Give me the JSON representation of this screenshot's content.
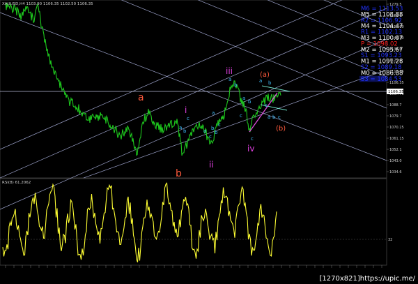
{
  "header": {
    "symbol_line": "XAUUSD,H4  1103.90 1106.35 1102.50 1106.35"
  },
  "levels": [
    {
      "label": "M6 = 1113.53",
      "color": "#2233ff",
      "highlight": false
    },
    {
      "label": "M5 = 1108.88",
      "color": "#ffffff",
      "highlight": false
    },
    {
      "label": "R2 = 1106.92",
      "color": "#2233ff",
      "highlight": false
    },
    {
      "label": "M4 = 1104.47",
      "color": "#ffffff",
      "highlight": false
    },
    {
      "label": "R1 = 1102.13",
      "color": "#2233ff",
      "highlight": false
    },
    {
      "label": "M3 = 1100.07",
      "color": "#ffffff",
      "highlight": false
    },
    {
      "label": "P = 1098.02",
      "color": "#ff2020",
      "highlight": false
    },
    {
      "label": "M2 = 1095.67",
      "color": "#ffffff",
      "highlight": false
    },
    {
      "label": "S1 = 1093.23",
      "color": "#2233ff",
      "highlight": false
    },
    {
      "label": "M1 = 1091.28",
      "color": "#ffffff",
      "highlight": false
    },
    {
      "label": "S2 = 1089.18",
      "color": "#2233ff",
      "highlight": false
    },
    {
      "label": "M0 = 1086.88",
      "color": "#ffffff",
      "highlight": false
    },
    {
      "label": "S3 = 1084.53",
      "color": "#2233ff",
      "highlight": true
    }
  ],
  "price_axis": [
    "1279.5",
    "1162.6",
    "1152.00",
    "1144.10",
    "1134.6",
    "1125.0",
    "1115.65",
    "1106.35",
    "1097.76",
    "1088.7",
    "1079.7",
    "1070.25",
    "1061.15",
    "1052.1",
    "1043.0",
    "1034.6"
  ],
  "current_price": "1106.35",
  "rsi": {
    "label": "RSI(8) 61.2062",
    "level_label": "32"
  },
  "wave_labels": [
    {
      "text": "a",
      "color": "#ff5a3c"
    },
    {
      "text": "b",
      "color": "#ff5a3c"
    },
    {
      "text": "i",
      "color": "#e040e0"
    },
    {
      "text": "ii",
      "color": "#e040e0"
    },
    {
      "text": "iii",
      "color": "#e040e0"
    },
    {
      "text": "iv",
      "color": "#e040e0"
    },
    {
      "text": "(a)",
      "color": "#ff5a3c"
    },
    {
      "text": "(b)",
      "color": "#ff5a3c"
    }
  ],
  "sub_labels": [
    "a",
    "b",
    "c",
    "a",
    "b",
    "c",
    "a",
    "b",
    "c",
    "a",
    "b",
    "c",
    "a",
    "b",
    "c",
    "a",
    "b",
    "c",
    "a",
    "b",
    "c"
  ],
  "colors": {
    "price": "#1ec81e",
    "rsi": "#ffff33",
    "channel": "#9aa0c8",
    "sub_label": "#40c0ff"
  },
  "footer": {
    "text": "[1270x821]https://upic.me/"
  }
}
